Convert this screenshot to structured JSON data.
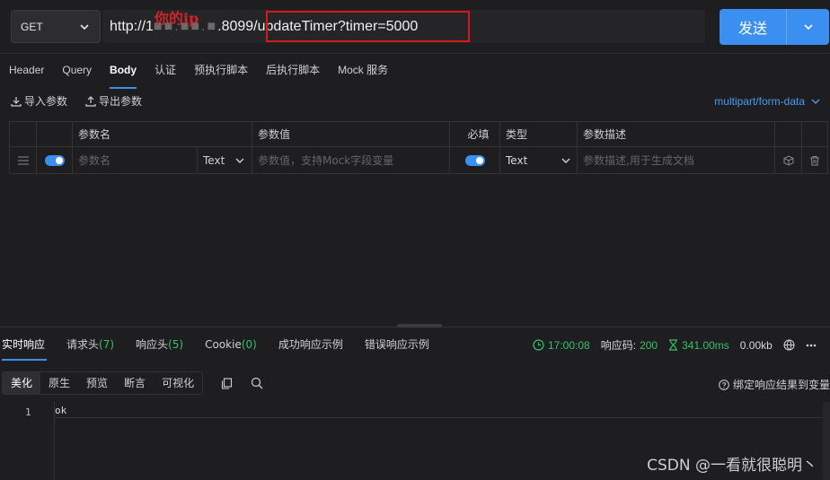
{
  "request": {
    "method": "GET",
    "url_visible": "http://1",
    "url_visible2": ".8099/updateTimer?timer=5000",
    "url_note": "你的ip",
    "send_label": "发送"
  },
  "tabs": [
    {
      "label": "Header"
    },
    {
      "label": "Query"
    },
    {
      "label": "Body"
    },
    {
      "label": "认证"
    },
    {
      "label": "预执行脚本"
    },
    {
      "label": "后执行脚本"
    },
    {
      "label": "Mock 服务"
    }
  ],
  "tools": {
    "import": "导入参数",
    "export": "导出参数"
  },
  "content_type": "multipart/form-data",
  "params": {
    "headers": [
      "参数名",
      "参数值",
      "必填",
      "类型",
      "参数描述"
    ],
    "row": {
      "name_placeholder": "参数名",
      "name_type": "Text",
      "value_placeholder": "参数值，支持Mock字段变量",
      "type": "Text",
      "desc_placeholder": "参数描述,用于生成文档"
    }
  },
  "response": {
    "tabs": [
      {
        "label": "实时响应",
        "count": ""
      },
      {
        "label": "请求头",
        "count": "7"
      },
      {
        "label": "响应头",
        "count": "5"
      },
      {
        "label": "Cookie",
        "count": "0"
      },
      {
        "label": "成功响应示例",
        "count": ""
      },
      {
        "label": "错误响应示例",
        "count": ""
      }
    ],
    "time": "17:00:08",
    "status_label": "响应码:",
    "status_code": "200",
    "duration": "341.00ms",
    "size": "0.00kb",
    "view_tabs": [
      "美化",
      "原生",
      "预览",
      "断言",
      "可视化"
    ],
    "bind_label": "绑定响应结果到变量",
    "line_number": "1",
    "body": "ok"
  },
  "watermark": "CSDN @一看就很聪明丶",
  "colors": {
    "accent": "#3a8ff0",
    "success": "#37c16b",
    "highlight": "#d9161b"
  }
}
